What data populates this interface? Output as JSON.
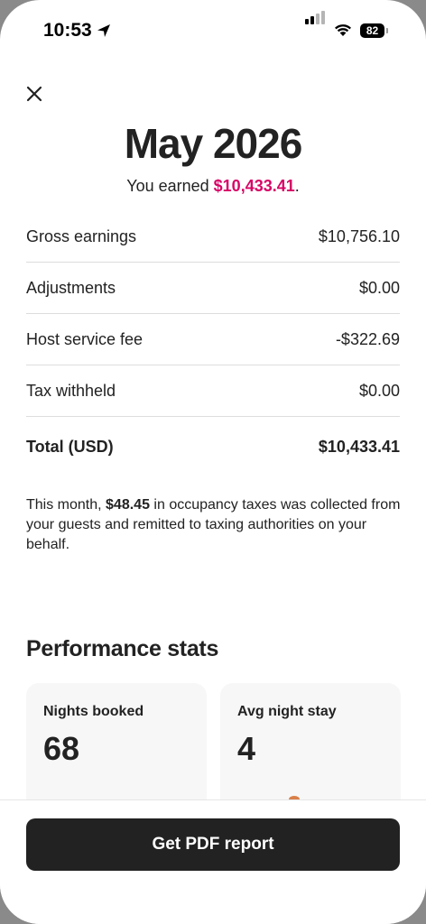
{
  "status_bar": {
    "time": "10:53",
    "battery": "82",
    "icons": [
      "location-arrow-icon",
      "cellular-signal-icon",
      "wifi-icon",
      "battery-icon"
    ]
  },
  "header": {
    "close_icon": "close-icon",
    "month": "May 2026",
    "earned_prefix": "You earned ",
    "earned_amount": "$10,433.41",
    "earned_suffix": "."
  },
  "breakdown": {
    "rows": [
      {
        "label": "Gross earnings",
        "value": "$10,756.10"
      },
      {
        "label": "Adjustments",
        "value": "$0.00"
      },
      {
        "label": "Host service fee",
        "value": "-$322.69"
      },
      {
        "label": "Tax withheld",
        "value": "$0.00"
      }
    ],
    "total": {
      "label": "Total (USD)",
      "value": "$10,433.41"
    }
  },
  "tax_note": {
    "prefix": "This month, ",
    "amount": "$48.45",
    "suffix": " in occupancy taxes was collected from your guests and remitted to taxing authorities on your behalf."
  },
  "performance": {
    "title": "Performance stats",
    "cards": [
      {
        "label": "Nights booked",
        "value": "68"
      },
      {
        "label": "Avg night stay",
        "value": "4"
      }
    ]
  },
  "footer": {
    "button_label": "Get PDF report"
  },
  "colors": {
    "accent": "#d70466",
    "text": "#222222",
    "button_bg": "#222222",
    "card_bg": "#f7f7f7"
  }
}
